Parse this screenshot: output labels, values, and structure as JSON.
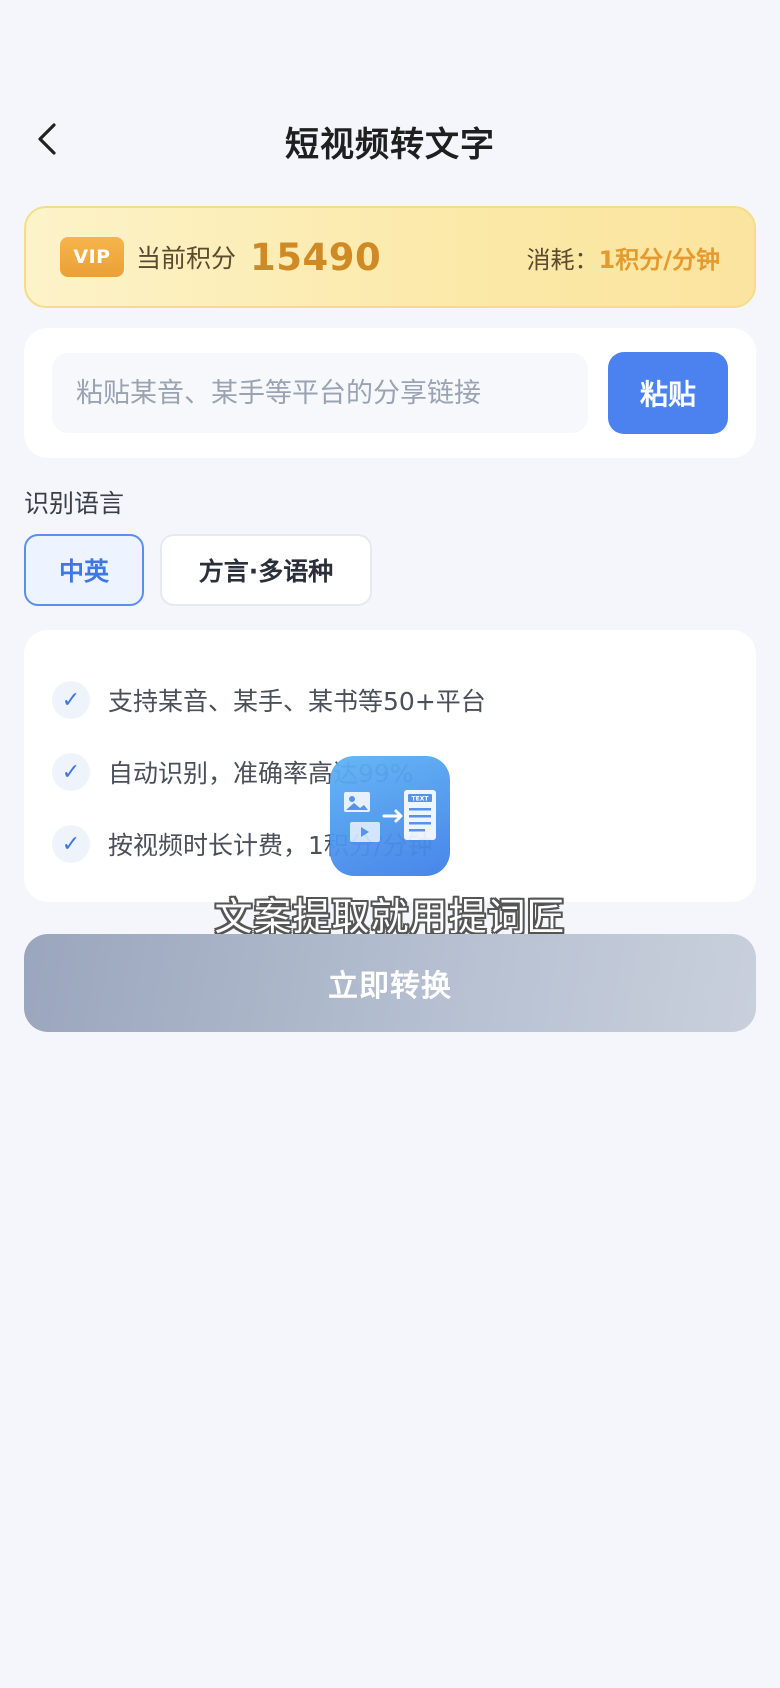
{
  "header": {
    "title": "短视频转文字",
    "back_icon": "chevron-left-icon"
  },
  "vip": {
    "badge": "VIP",
    "points_label": "当前积分",
    "points_value": "15490",
    "cost_label": "消耗：",
    "cost_value": "1积分/分钟"
  },
  "link_input": {
    "placeholder": "粘贴某音、某手等平台的分享链接",
    "value": "",
    "paste_label": "粘贴"
  },
  "language": {
    "label": "识别语言",
    "options": [
      {
        "label": "中英",
        "selected": true
      },
      {
        "label": "方言·多语种",
        "selected": false
      }
    ]
  },
  "features": {
    "items": [
      {
        "text": "支持某音、某手、某书等50+平台"
      },
      {
        "text": "自动识别，准确率高达99%"
      },
      {
        "text": "按视频时长计费，1积分/分钟"
      }
    ],
    "icon": "check-icon"
  },
  "overlay": {
    "logo_icon": "image-to-text-logo-icon",
    "logo_tag": "TEXT",
    "caption": "文案提取就用提词匠"
  },
  "convert": {
    "label": "立即转换"
  },
  "colors": {
    "accent": "#4c82f0",
    "vip_gold": "#d08a25",
    "background": "#f4f6fb",
    "disabled_button": "#b7c1d2"
  }
}
